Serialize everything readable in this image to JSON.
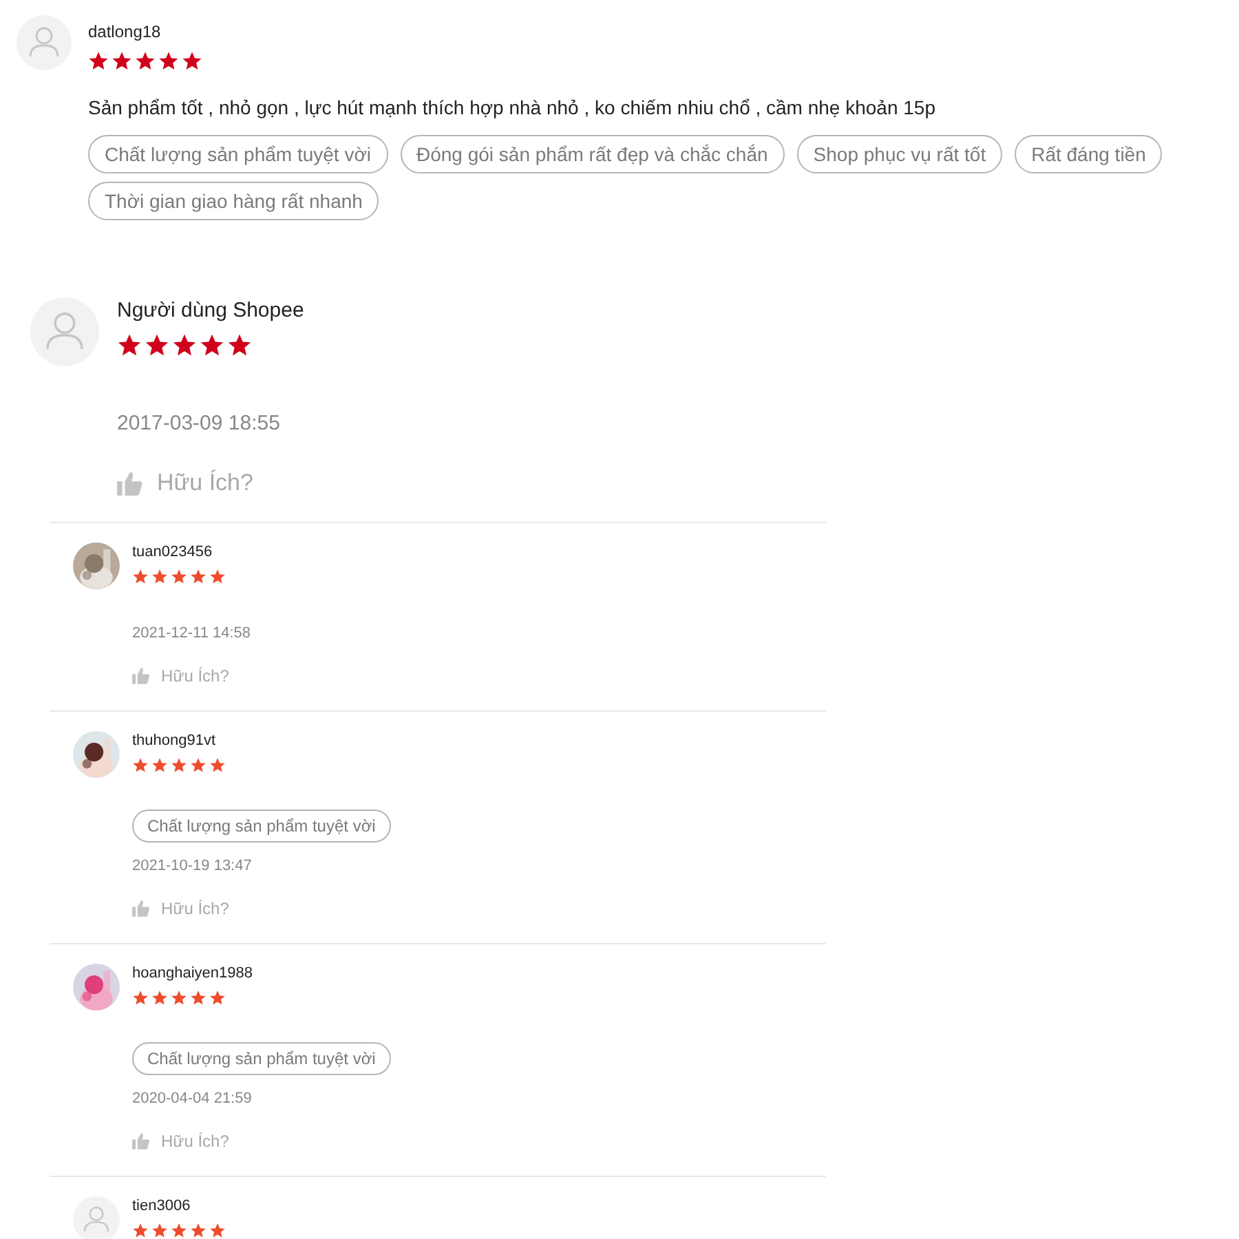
{
  "panels": [
    {
      "kind": "large",
      "color": "#d0011b",
      "reviews": [
        {
          "username": "datlong18",
          "avatar": {
            "kind": "default"
          },
          "stars": 5,
          "comment": "Sản phẩm tốt , nhỏ gọn , lực hút mạnh thích hợp nhà nhỏ , ko chiếm nhiu chổ , cầm nhẹ khoản 15p",
          "tags": [
            "Chất lượng sản phẩm tuyệt vời",
            "Đóng gói sản phẩm rất đẹp và chắc chắn",
            "Shop phục vụ rất tốt",
            "Rất đáng tiền",
            "Thời gian giao hàng rất nhanh"
          ]
        }
      ]
    },
    {
      "kind": "medium",
      "color": "#d0011b",
      "reviews": [
        {
          "username": "Người dùng Shopee",
          "avatar": {
            "kind": "default"
          },
          "stars": 5,
          "date": "2017-03-09 18:55",
          "helpful": "Hữu Ích?"
        }
      ]
    },
    {
      "kind": "small",
      "color": "#ee4d2d",
      "reviews": [
        {
          "username": "tuan023456",
          "stars": 5,
          "date": "2021-12-11 14:58",
          "helpful": "Hữu Ích?"
        },
        {
          "username": "thuhong91vt",
          "stars": 5,
          "tags": [
            "Chất lượng sản phẩm tuyệt vời"
          ],
          "date": "2021-10-19 13:47",
          "helpful": "Hữu Ích?"
        },
        {
          "username": "hoanghaiyen1988",
          "stars": 5,
          "tags": [
            "Chất lượng sản phẩm tuyệt vời"
          ],
          "date": "2020-04-04 21:59",
          "helpful": "Hữu Ích?"
        },
        {
          "username": "tien3006",
          "avatar": {
            "kind": "default"
          },
          "stars": 5
        }
      ]
    }
  ]
}
